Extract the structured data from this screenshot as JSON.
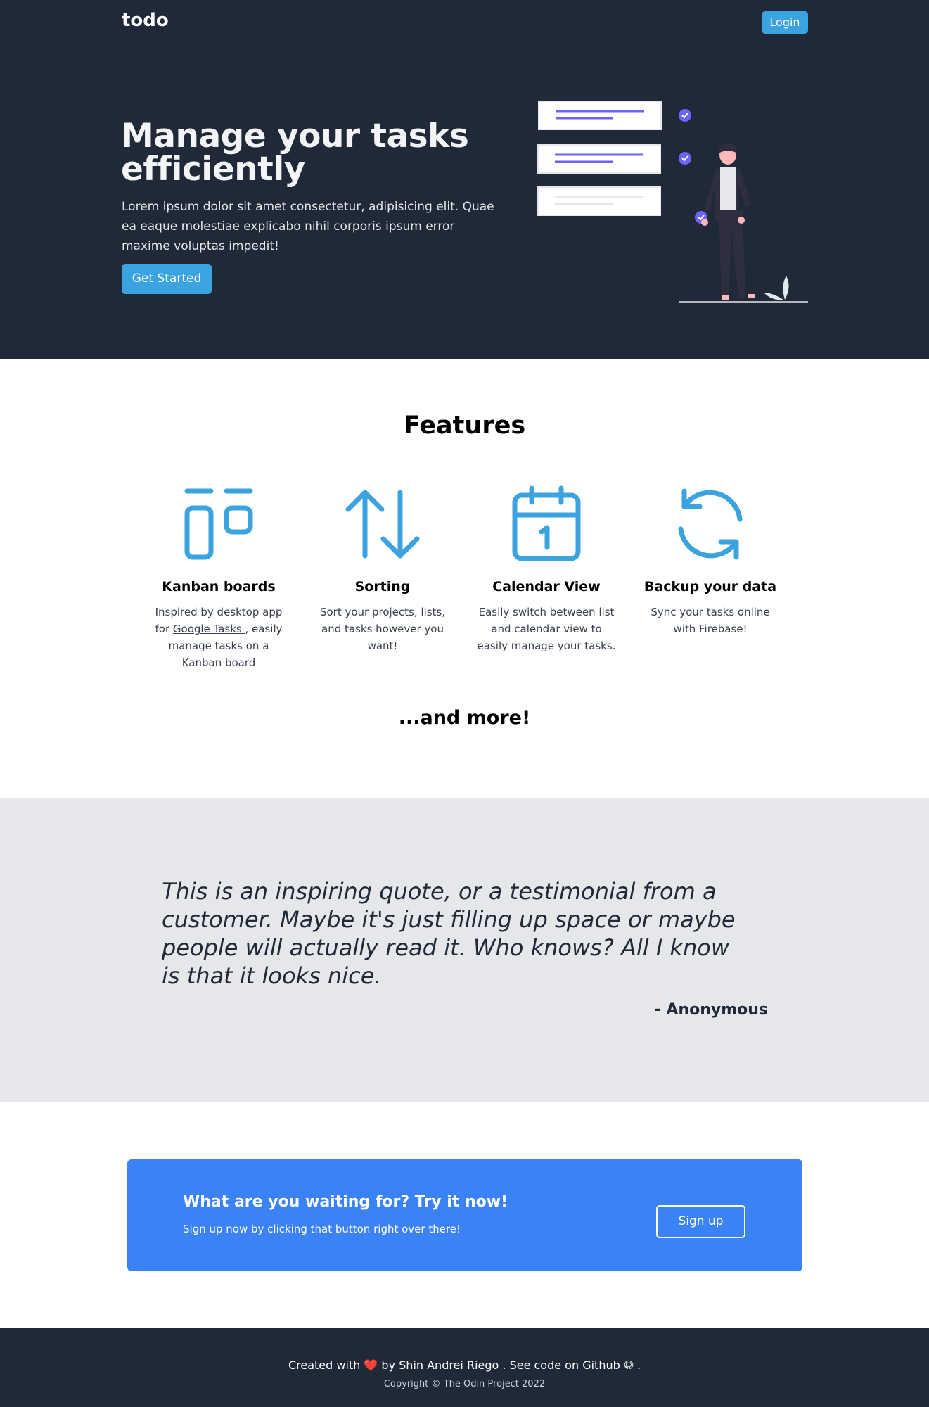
{
  "header": {
    "logo": "todo",
    "login_label": "Login"
  },
  "hero": {
    "title": "Manage your tasks efficiently",
    "text": "Lorem ipsum dolor sit amet consectetur, adipisicing elit. Quae ea eaque molestiae explicabo nihil corporis ipsum error maxime voluptas impedit!",
    "cta_label": "Get Started",
    "illustration_icon": "task-checklist-illustration"
  },
  "features": {
    "title": "Features",
    "items": [
      {
        "icon": "kanban-icon",
        "title": "Kanban boards",
        "desc_before": "Inspired by desktop app for ",
        "link": "Google Tasks ",
        "desc_after": ", easily manage tasks on a Kanban board"
      },
      {
        "icon": "sort-arrows-icon",
        "title": "Sorting",
        "desc": "Sort your projects, lists, and tasks however you want!"
      },
      {
        "icon": "calendar-icon",
        "title": "Calendar View",
        "desc": "Easily switch between list and calendar view to easily manage your tasks."
      },
      {
        "icon": "refresh-icon",
        "title": "Backup your data",
        "desc": "Sync your tasks online with Firebase!"
      }
    ],
    "more": "...and more!"
  },
  "quote": {
    "text": "This is an inspiring quote, or a testimonial from a customer. Maybe it's just filling up space or maybe people will actually read it. Who knows? All I know is that it looks nice.",
    "author": "- Anonymous"
  },
  "cta": {
    "title": "What are you waiting for? Try it now!",
    "text": "Sign up now by clicking that button right over there!",
    "button": "Sign up"
  },
  "footer": {
    "created_with": "Created with",
    "heart": "❤️",
    "by": "by",
    "author": "Shin Andrei Riego",
    "see_code": ". See code on",
    "github": "Github",
    "end": ".",
    "copyright": "Copyright © The Odin Project 2022"
  },
  "colors": {
    "dark_bg": "#1f2937",
    "accent": "#3ba3e0",
    "cta_bg": "#3b82f6",
    "quote_bg": "#e5e7eb",
    "illustration_purple": "#6c63ff"
  }
}
